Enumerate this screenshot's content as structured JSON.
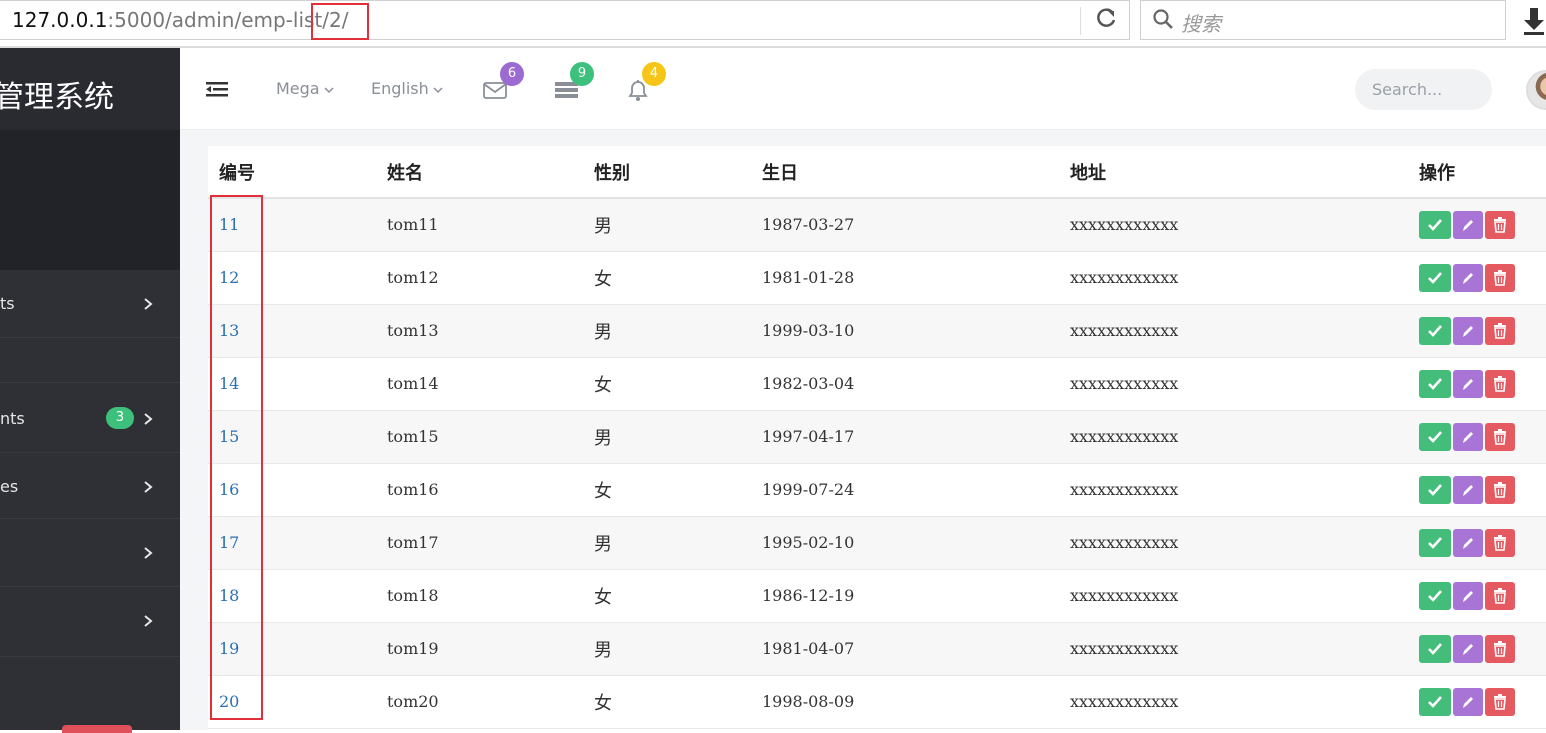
{
  "browser": {
    "url_host": "127.0.0.1",
    "url_rest": ":5000/admin/emp-list/2/",
    "search_placeholder": "搜索"
  },
  "sidebar": {
    "brand": "管理系统",
    "items": [
      {
        "label": "ts",
        "badge": ""
      },
      {
        "label": "",
        "badge": ""
      },
      {
        "label": "nts",
        "badge": "3"
      },
      {
        "label": "es",
        "badge": ""
      },
      {
        "label": "",
        "badge": ""
      },
      {
        "label": "",
        "badge": ""
      }
    ]
  },
  "topbar": {
    "mega": "Mega",
    "language": "English",
    "mail_count": "6",
    "tasks_count": "9",
    "bell_count": "4",
    "search_placeholder": "Search...",
    "colors": {
      "mail": "#9b6bd1",
      "tasks": "#3cc07b",
      "bell": "#f5c518"
    }
  },
  "table": {
    "headers": [
      "编号",
      "姓名",
      "性别",
      "生日",
      "地址",
      "操作"
    ],
    "rows": [
      {
        "id": "11",
        "name": "tom11",
        "gender": "男",
        "birthday": "1987-03-27",
        "address": "xxxxxxxxxxxx"
      },
      {
        "id": "12",
        "name": "tom12",
        "gender": "女",
        "birthday": "1981-01-28",
        "address": "xxxxxxxxxxxx"
      },
      {
        "id": "13",
        "name": "tom13",
        "gender": "男",
        "birthday": "1999-03-10",
        "address": "xxxxxxxxxxxx"
      },
      {
        "id": "14",
        "name": "tom14",
        "gender": "女",
        "birthday": "1982-03-04",
        "address": "xxxxxxxxxxxx"
      },
      {
        "id": "15",
        "name": "tom15",
        "gender": "男",
        "birthday": "1997-04-17",
        "address": "xxxxxxxxxxxx"
      },
      {
        "id": "16",
        "name": "tom16",
        "gender": "女",
        "birthday": "1999-07-24",
        "address": "xxxxxxxxxxxx"
      },
      {
        "id": "17",
        "name": "tom17",
        "gender": "男",
        "birthday": "1995-02-10",
        "address": "xxxxxxxxxxxx"
      },
      {
        "id": "18",
        "name": "tom18",
        "gender": "女",
        "birthday": "1986-12-19",
        "address": "xxxxxxxxxxxx"
      },
      {
        "id": "19",
        "name": "tom19",
        "gender": "男",
        "birthday": "1981-04-07",
        "address": "xxxxxxxxxxxx"
      },
      {
        "id": "20",
        "name": "tom20",
        "gender": "女",
        "birthday": "1998-08-09",
        "address": "xxxxxxxxxxxx"
      }
    ]
  },
  "colors": {
    "ok": "#45bd7a",
    "edit": "#a874d6",
    "delete": "#e55a60",
    "annotation": "#e0313b"
  }
}
